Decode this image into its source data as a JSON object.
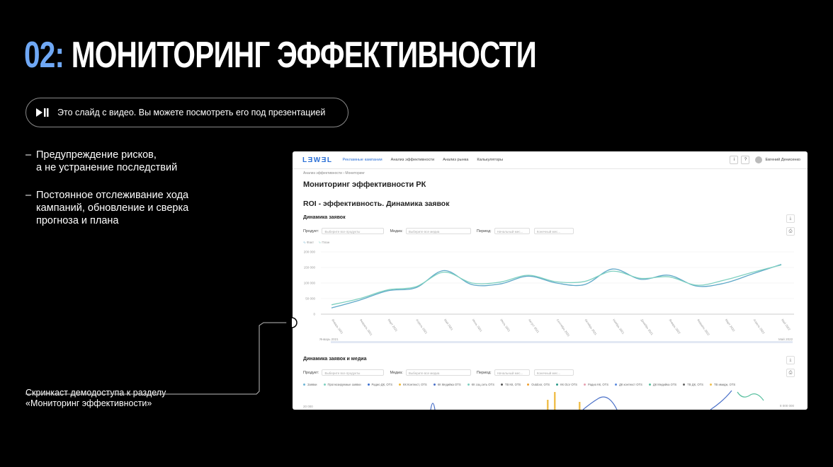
{
  "slide": {
    "title_number": "02:",
    "title_text": "МОНИТОРИНГ ЭФФЕКТИВНОСТИ",
    "video_notice": "Это слайд с видео. Вы можете посмотреть его под презентацией",
    "bullets": [
      "Предупреждение рисков,\nа не устранение последствий",
      "Постоянное отслеживание хода\nкампаний, обновление и сверка\nпрогноза и плана"
    ],
    "caption": "Скринкаст демодоступа к разделу\n«Мониторинг эффективности»",
    "colors": {
      "background": "#000000",
      "accent": "#6fa8f5",
      "text": "#ffffff"
    }
  },
  "app": {
    "logo": "LƎWƎL",
    "nav": [
      "Рекламные кампании",
      "Анализ эффективности",
      "Анализ рынка",
      "Калькуляторы"
    ],
    "user_name": "Евгений Денисенко",
    "info_btn": "i",
    "help_btn": "?",
    "breadcrumb": "Анализ эффективности  ›  Мониторинг",
    "page_title": "Мониторинг эффективности РК",
    "section_title": "ROI - эффективность. Динамика заявок",
    "chart1": {
      "title": "Динамика заявок",
      "filter_product_label": "Продукт:",
      "filter_product_placeholder": "Выберите все продукты",
      "filter_media_label": "Медиа:",
      "filter_media_placeholder": "Выберите все медиа",
      "filter_period_label": "Период:",
      "filter_period_from": "Начальный мес...",
      "filter_period_to": "Конечный мес...",
      "legend": [
        "Факт",
        "План"
      ],
      "range_start": "Январь 2021",
      "range_end": "Май 2022"
    },
    "chart2": {
      "title": "Динамика заявок и медиа",
      "filter_product_label": "Продукт:",
      "filter_product_placeholder": "Выберите все продукты",
      "filter_media_label": "Медиа:",
      "filter_media_placeholder": "Выберите все медиа",
      "filter_period_label": "Период:",
      "filter_period_from": "Начальный мес...",
      "filter_period_to": "Конечный мес...",
      "legend": [
        {
          "name": "Заявки",
          "color": "#6fb6d6"
        },
        {
          "name": "Прогнозируемые заявки",
          "color": "#7fd0c0"
        },
        {
          "name": "Радио ДК, OTS",
          "color": "#3a6fd0"
        },
        {
          "name": "КК Контекст, OTS",
          "color": "#f0b93a"
        },
        {
          "name": "КК Медийка OTS",
          "color": "#4a70c8"
        },
        {
          "name": "КК соц.сеть OTS",
          "color": "#7fd0c0"
        },
        {
          "name": "ТВ КК, OTS",
          "color": "#555555"
        },
        {
          "name": "Outdoor, OTS",
          "color": "#f0a030"
        },
        {
          "name": "КК OLV OTS",
          "color": "#2a9a8a"
        },
        {
          "name": "Радио КК, OTS",
          "color": "#e8a0b0"
        },
        {
          "name": "ДК контекст OTS",
          "color": "#5a8ae0"
        },
        {
          "name": "ДК Медийка OTS",
          "color": "#5ac0a0"
        },
        {
          "name": "ТВ ДК, OTS",
          "color": "#666666"
        },
        {
          "name": "ТВ имидж, OTS",
          "color": "#f0c050"
        }
      ],
      "y_left_top": "20 000",
      "y_right_top": "8 000 000"
    }
  },
  "chart_data": {
    "type": "line",
    "title": "Динамика заявок",
    "x": [
      "Январь 2021",
      "Февраль 2021",
      "Март 2021",
      "Апрель 2021",
      "Май 2021",
      "Июнь 2021",
      "Июль 2021",
      "Август 2021",
      "Сентябрь 2021",
      "Октябрь 2021",
      "Ноябрь 2021",
      "Декабрь 2021",
      "Январь 2022",
      "Февраль 2022",
      "Март 2022",
      "Апрель 2022",
      "Май 2022"
    ],
    "yticks": [
      "200 000",
      "150 000",
      "100 000",
      "50 000",
      "0"
    ],
    "ylim": [
      0,
      200000
    ],
    "series": [
      {
        "name": "Факт",
        "color": "#5fa8c8",
        "values": [
          20000,
          45000,
          75000,
          85000,
          140000,
          95000,
          97000,
          122000,
          100000,
          95000,
          145000,
          112000,
          125000,
          90000,
          100000,
          130000,
          160000
        ]
      },
      {
        "name": "План",
        "color": "#7fd0c0",
        "values": [
          30000,
          50000,
          78000,
          88000,
          135000,
          100000,
          103000,
          125000,
          104000,
          105000,
          138000,
          115000,
          120000,
          93000,
          110000,
          135000,
          158000
        ]
      }
    ]
  }
}
